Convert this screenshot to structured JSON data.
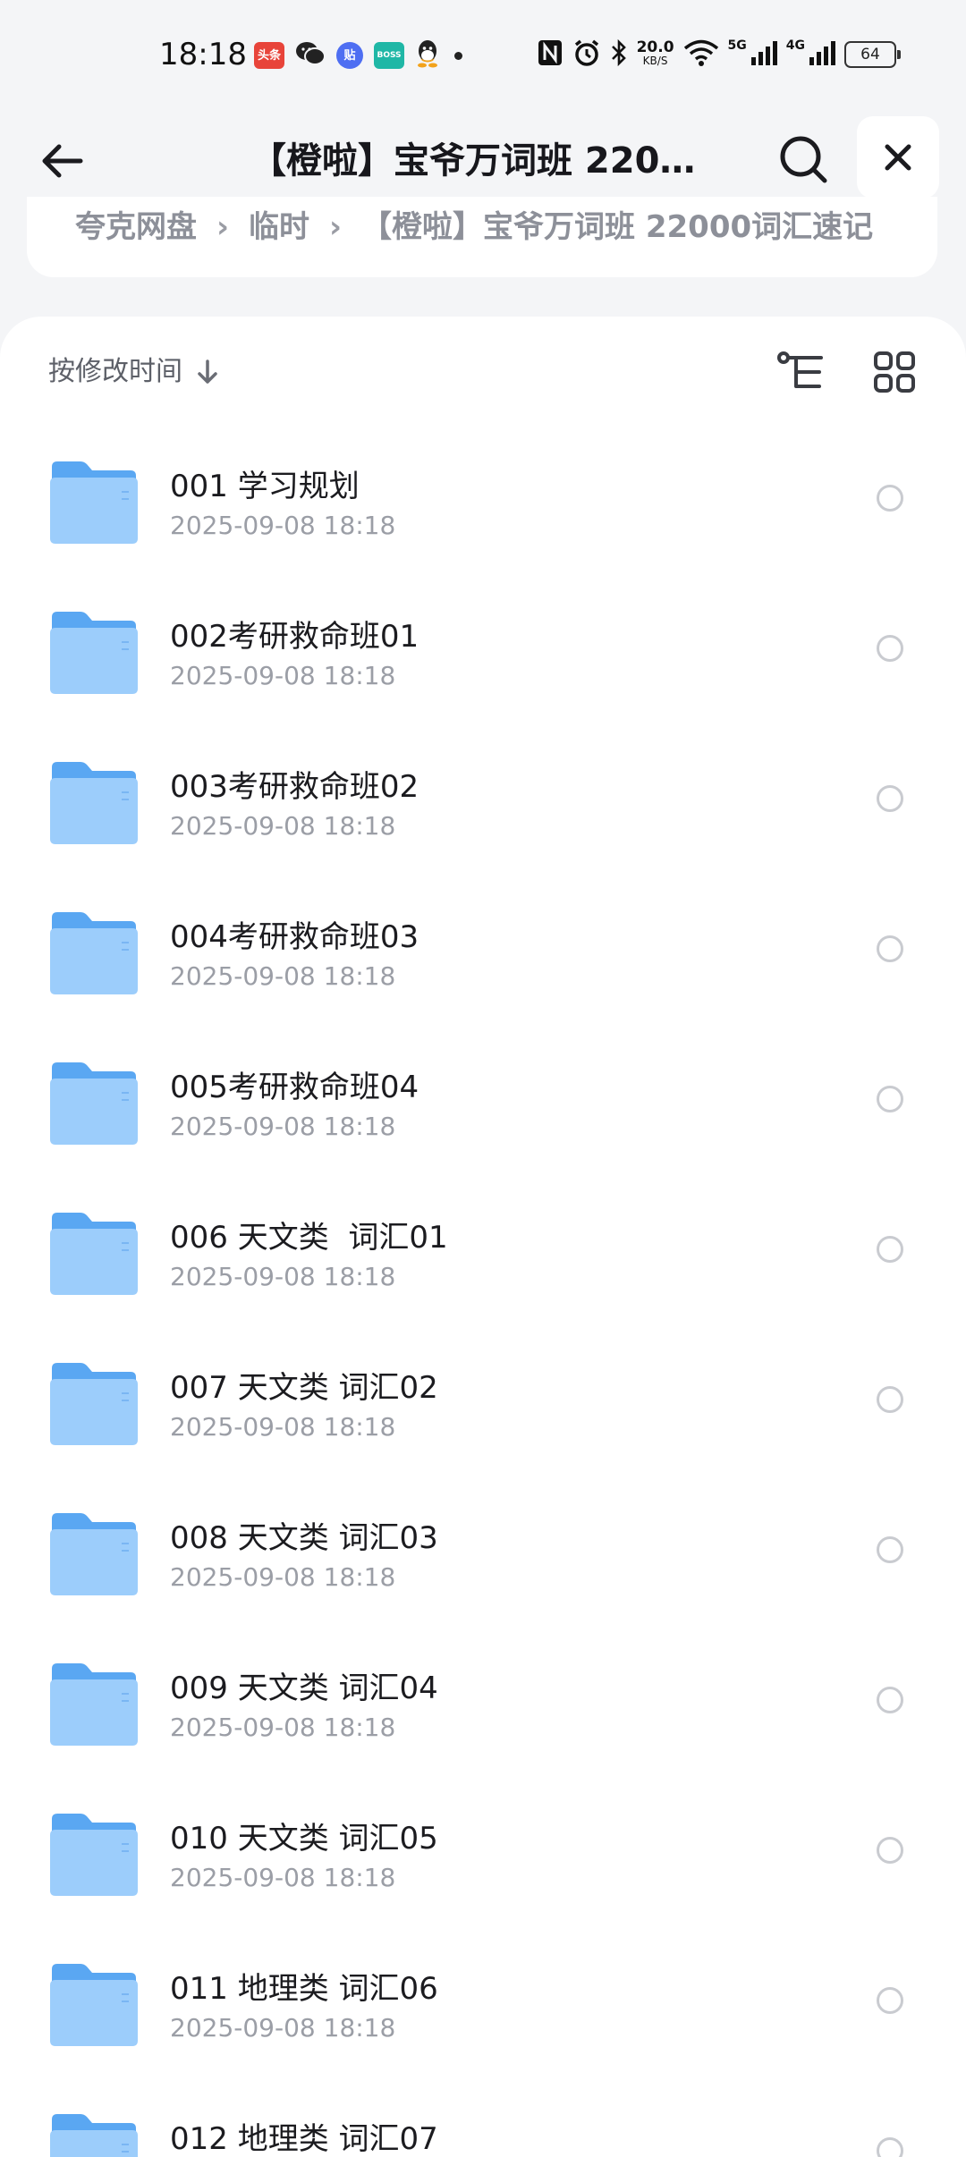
{
  "status_bar": {
    "time": "18:18",
    "apps": [
      {
        "name": "toutiao-icon",
        "text": "头条",
        "color": "#e8443a"
      },
      {
        "name": "wechat-icon",
        "text": "",
        "color": "#222222"
      },
      {
        "name": "tieba-icon",
        "text": "贴",
        "color": "#4e6ef2"
      },
      {
        "name": "boss-icon",
        "text": "BOSS",
        "color": "#1fb7a6"
      },
      {
        "name": "qq-icon",
        "text": "",
        "color": "#222222"
      }
    ],
    "speed_value": "20.0",
    "speed_unit": "KB/S",
    "net_5g": "5G",
    "net_4g": "4G",
    "battery": "64"
  },
  "header": {
    "title": "【橙啦】宝爷万词班 2200..."
  },
  "breadcrumb": {
    "items": [
      "夸克网盘",
      "临时",
      "【橙啦】宝爷万词班 22000词汇速记"
    ]
  },
  "sort": {
    "label": "按修改时间"
  },
  "files": [
    {
      "name": "001 学习规划",
      "date": "2025-09-08 18:18"
    },
    {
      "name": "002考研救命班01",
      "date": "2025-09-08 18:18"
    },
    {
      "name": "003考研救命班02",
      "date": "2025-09-08 18:18"
    },
    {
      "name": "004考研救命班03",
      "date": "2025-09-08 18:18"
    },
    {
      "name": "005考研救命班04",
      "date": "2025-09-08 18:18"
    },
    {
      "name": "006 天文类  词汇01",
      "date": "2025-09-08 18:18"
    },
    {
      "name": "007 天文类 词汇02",
      "date": "2025-09-08 18:18"
    },
    {
      "name": "008 天文类 词汇03",
      "date": "2025-09-08 18:18"
    },
    {
      "name": "009 天文类 词汇04",
      "date": "2025-09-08 18:18"
    },
    {
      "name": "010 天文类 词汇05",
      "date": "2025-09-08 18:18"
    },
    {
      "name": "011 地理类 词汇06",
      "date": "2025-09-08 18:18"
    },
    {
      "name": "012 地理类 词汇07",
      "date": ""
    }
  ],
  "colors": {
    "folder_back": "#5aa7f2",
    "folder_front": "#8cc6fb",
    "accent_text": "#1b1b1f",
    "muted_text": "#9b9ea6"
  }
}
